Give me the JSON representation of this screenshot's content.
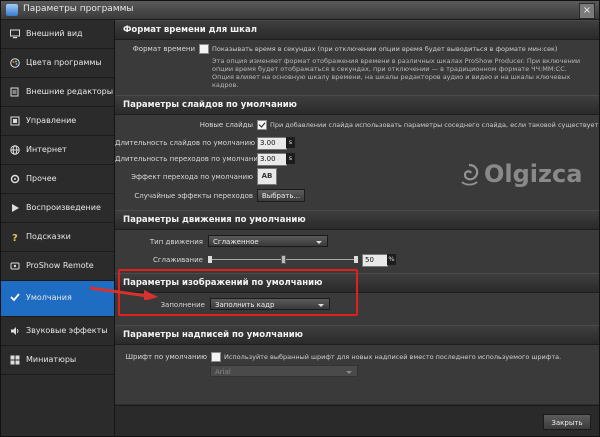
{
  "window": {
    "title": "Параметры программы",
    "close_glyph": "×"
  },
  "sidebar": {
    "items": [
      {
        "label": "Внешний вид",
        "icon": "monitor-icon",
        "active": false
      },
      {
        "label": "Цвета программы",
        "icon": "palette-icon",
        "active": false
      },
      {
        "label": "Внешние редакторы",
        "icon": "external-editor-icon",
        "active": false
      },
      {
        "label": "Управление",
        "icon": "control-icon",
        "active": false
      },
      {
        "label": "Интернет",
        "icon": "globe-icon",
        "active": false
      },
      {
        "label": "Прочее",
        "icon": "misc-icon",
        "active": false
      },
      {
        "label": "Воспроизведение",
        "icon": "play-icon",
        "active": false
      },
      {
        "label": "Подсказки",
        "icon": "question-icon",
        "active": false
      },
      {
        "label": "ProShow Remote",
        "icon": "remote-icon",
        "active": false
      },
      {
        "label": "Умолчания",
        "icon": "checkmark-icon",
        "active": true
      },
      {
        "label": "Звуковые эффекты",
        "icon": "sound-icon",
        "active": false
      },
      {
        "label": "Миниатюры",
        "icon": "thumbnails-icon",
        "active": false
      }
    ]
  },
  "sections": {
    "time_format": {
      "title": "Формат времени для шкал",
      "label": "Формат времени",
      "checkbox_text": "Показывать время в секундах (при отключении опции время будет выводиться в формате мин:сек)",
      "checked": false,
      "description": "Эта опция изменяет формат отображения времени в различных шкалах ProShow Producer. При включении опции время будет отображаться в секундах, при отключении — в традиционном формате ЧЧ:ММ:СС. Опция влияет на основную шкалу времени, на шкалы редакторов аудио и видео и на шкалы ключевых кадров."
    },
    "slides": {
      "title": "Параметры слайдов по умолчанию",
      "new_slides_label": "Новые слайды",
      "new_slides_text": "При добавлении слайда использовать параметры соседнего слайда, если таковой существует.",
      "new_slides_checked": true,
      "slide_duration_label": "Длительность слайдов по умолчанию",
      "slide_duration_value": "3.00",
      "slide_duration_unit": "s",
      "transition_duration_label": "Длительность переходов по умолчанию",
      "transition_duration_value": "3.00",
      "transition_duration_unit": "s",
      "transition_effect_label": "Эффект перехода по умолчанию",
      "transition_effect_text": "AB",
      "random_effects_label": "Случайные эффекты переходов",
      "choose_button": "Выбрать..."
    },
    "motion": {
      "title": "Параметры движения по умолчанию",
      "motion_type_label": "Тип движения",
      "motion_type_value": "Сглаженное",
      "smoothing_label": "Сглаживание",
      "smoothing_value": "50",
      "smoothing_fraction": 0.5,
      "smoothing_unit": "%"
    },
    "images": {
      "title": "Параметры изображений по умолчанию",
      "fill_label": "Заполнение",
      "fill_value": "Заполнить кадр"
    },
    "captions": {
      "title": "Параметры надписей по умолчанию",
      "font_label": "Шрифт по умолчанию",
      "font_checkbox_text": "Используйте выбранный шрифт для новых надписей вместо последнего используемого шрифта.",
      "font_checked": false,
      "font_value": "Arial"
    }
  },
  "footer": {
    "close_button": "Закрыть"
  },
  "watermark": {
    "text": "Olgizca",
    "icon": "logo-swirl-icon"
  },
  "colors": {
    "accent": "#1f6cc3",
    "highlight": "#e0201b",
    "arrow": "#d8322e"
  }
}
